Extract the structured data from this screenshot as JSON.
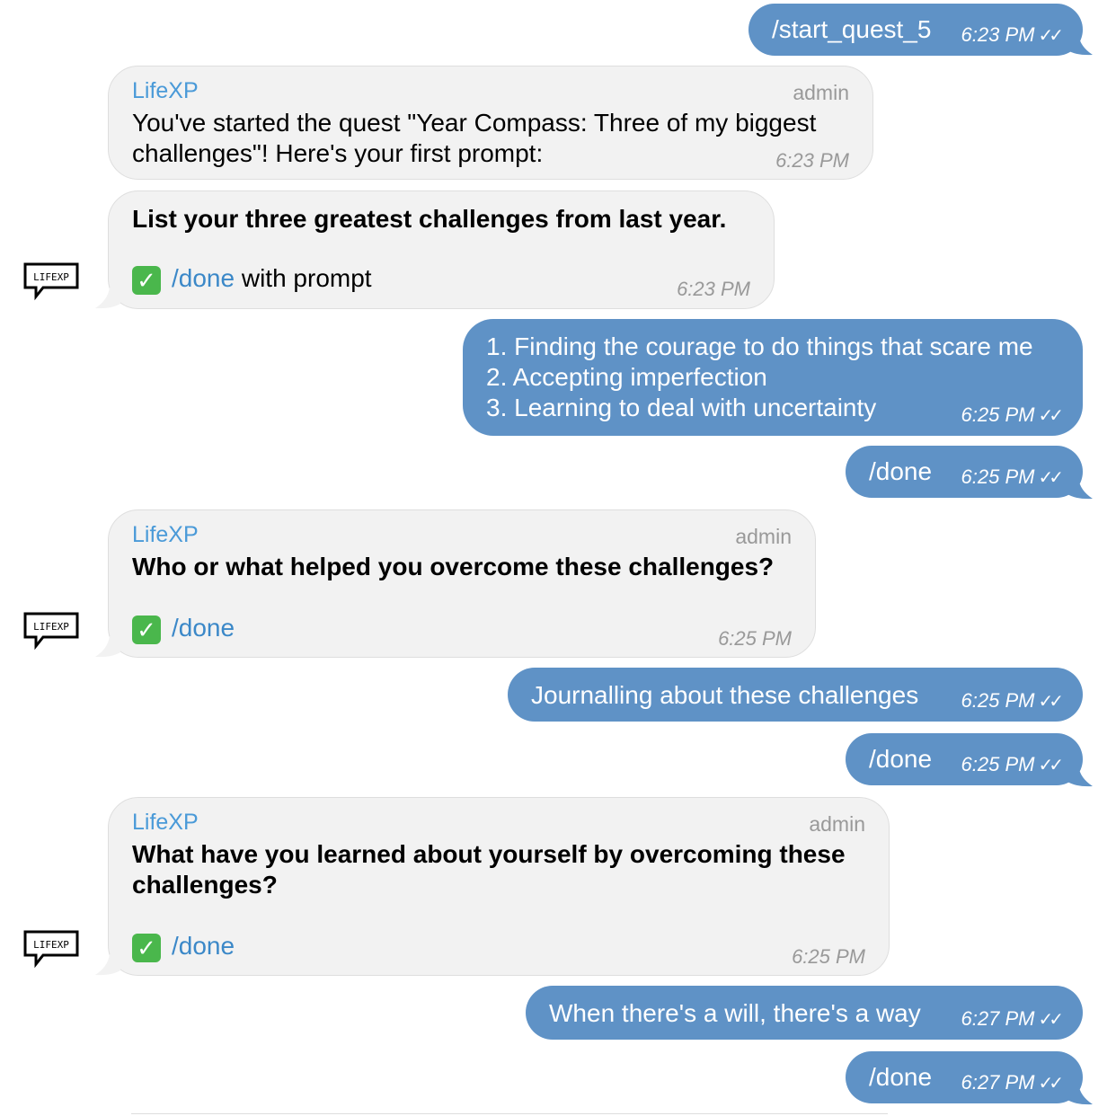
{
  "chat": {
    "bot_name": "LifeXP",
    "bot_role": "admin",
    "avatar_text": "LIFEXP",
    "colors": {
      "outgoing": "#5f92c6",
      "incoming": "#f2f2f2",
      "link": "#3b88c8",
      "sender": "#4a9ad8"
    },
    "messages": [
      {
        "dir": "out",
        "text": "/start_quest_5",
        "time": "6:23 PM"
      },
      {
        "dir": "in",
        "sender": "LifeXP",
        "role": "admin",
        "text_line1": "You've started the quest \"Year Compass: Three of my biggest",
        "text_line2": "challenges\"! Here's your first prompt:",
        "time": "6:23 PM"
      },
      {
        "dir": "in",
        "prompt": "List your three greatest challenges from last year.",
        "command": "/done",
        "command_suffix": "with prompt",
        "time": "6:23 PM"
      },
      {
        "dir": "out",
        "lines": [
          "1. Finding the courage to do things that scare me",
          "2. Accepting imperfection",
          "3. Learning to deal with uncertainty"
        ],
        "time": "6:25 PM"
      },
      {
        "dir": "out",
        "text": "/done",
        "time": "6:25 PM"
      },
      {
        "dir": "in",
        "sender": "LifeXP",
        "role": "admin",
        "prompt": "Who or what helped you overcome these challenges?",
        "command": "/done",
        "time": "6:25 PM"
      },
      {
        "dir": "out",
        "text": "Journalling about these challenges",
        "time": "6:25 PM"
      },
      {
        "dir": "out",
        "text": "/done",
        "time": "6:25 PM"
      },
      {
        "dir": "in",
        "sender": "LifeXP",
        "role": "admin",
        "prompt_line1": "What have you learned about yourself by overcoming these",
        "prompt_line2": "challenges?",
        "command": "/done",
        "time": "6:25 PM"
      },
      {
        "dir": "out",
        "text": "When there's a will, there's a way",
        "time": "6:27 PM"
      },
      {
        "dir": "out",
        "text": "/done",
        "time": "6:27 PM"
      }
    ]
  }
}
